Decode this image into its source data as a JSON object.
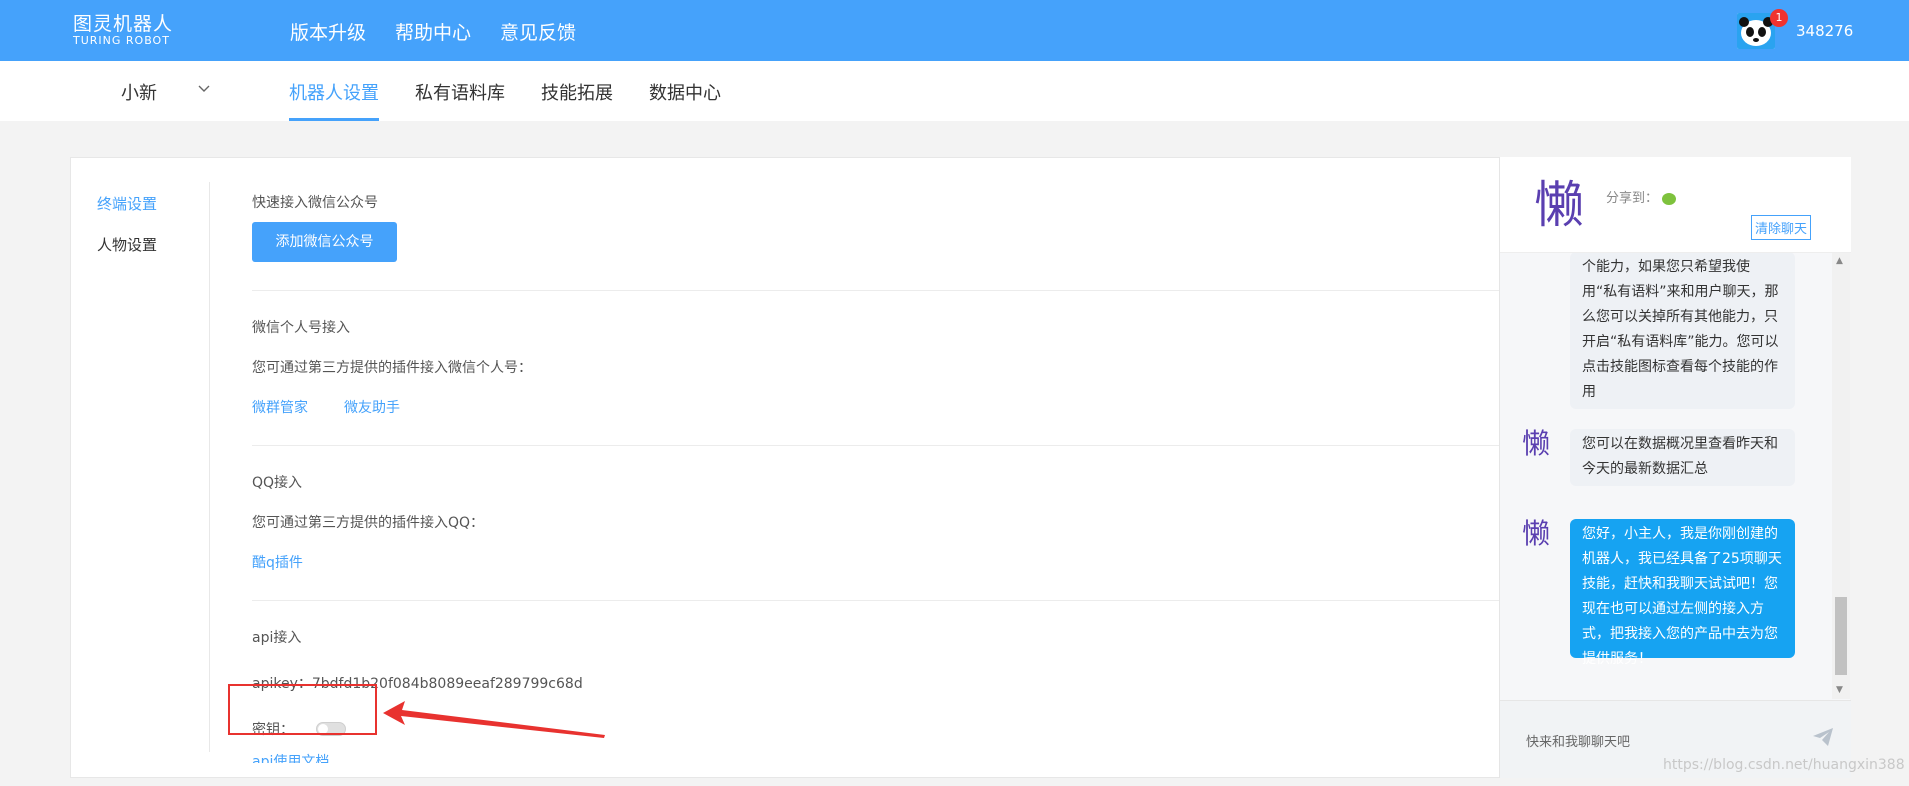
{
  "header": {
    "logo_cn": "图灵机器人",
    "logo_en": "TURING ROBOT",
    "nav": [
      "版本升级",
      "帮助中心",
      "意见反馈"
    ],
    "notification_count": "1",
    "username": "348276",
    "brand_color": "#45a2fb"
  },
  "subnav": {
    "bot_name": "小新",
    "tabs": [
      "机器人设置",
      "私有语料库",
      "技能拓展",
      "数据中心"
    ],
    "active_tab": "机器人设置"
  },
  "sidebar": {
    "items": [
      "终端设置",
      "人物设置"
    ],
    "active": "终端设置"
  },
  "sections": {
    "wechat_official": {
      "title": "快速接入微信公众号",
      "button": "添加微信公众号"
    },
    "wechat_personal": {
      "title": "微信个人号接入",
      "desc": "您可通过第三方提供的插件接入微信个人号：",
      "links": [
        "微群管家",
        "微友助手"
      ]
    },
    "qq": {
      "title": "QQ接入",
      "desc": "您可通过第三方提供的插件接入QQ：",
      "links": [
        "酷q插件"
      ]
    },
    "api": {
      "title": "api接入",
      "apikey": "apikey：7bdfd1b20f084b8089eeaf289799c68d",
      "secret_label": "密钥：",
      "secret_enabled": false,
      "doc_link": "api使用文档"
    }
  },
  "chat": {
    "avatar_char": "懒",
    "share_label": "分享到：",
    "share_icon": "wechat-icon",
    "clear_button": "清除聊天",
    "messages": [
      "个能力，如果您只希望我使用“私有语料”来和用户聊天，那么您可以关掉所有其他能力，只开启“私有语料库”能力。您可以点击技能图标查看每个技能的作用",
      "您可以在数据概况里查看昨天和今天的最新数据汇总",
      "您好，小主人，我是你刚创建的机器人，我已经具备了25项聊天技能，赶快和我聊天试试吧！您现在也可以通过左侧的接入方式，把我接入您的产品中去为您提供服务！"
    ],
    "input_placeholder": "快来和我聊聊天吧"
  },
  "watermark": "https://blog.csdn.net/huangxin388"
}
